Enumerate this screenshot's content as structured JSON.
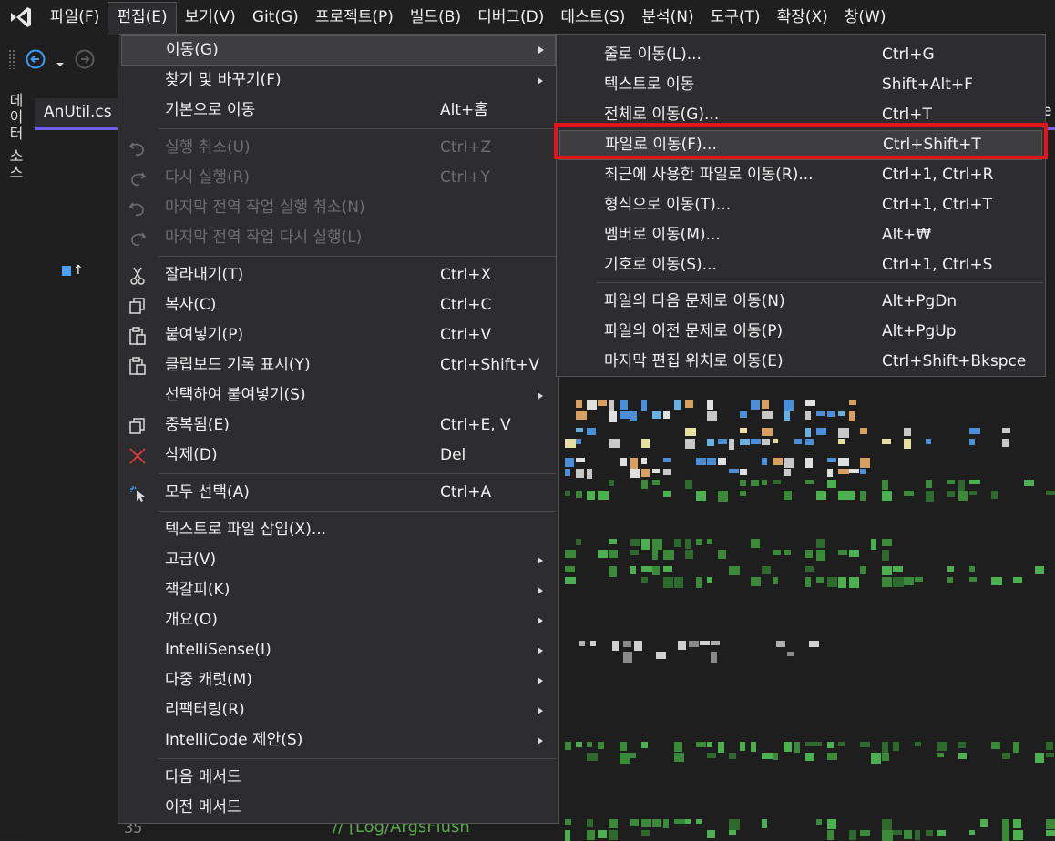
{
  "colors": {
    "accent": "#7160e8",
    "highlight_box": "#e3151a",
    "menu_bg": "#2d2d30",
    "disabled": "#6d6d6d"
  },
  "menubar": {
    "logo_icon": "visual-studio-logo-icon",
    "items": [
      "파일(F)",
      "편집(E)",
      "보기(V)",
      "Git(G)",
      "프로젝트(P)",
      "빌드(B)",
      "디버그(D)",
      "테스트(S)",
      "분석(N)",
      "도구(T)",
      "확장(X)",
      "창(W)"
    ],
    "open_index": 1
  },
  "toolbar": {
    "back_icon": "back-arrow-icon",
    "forward_icon": "forward-arrow-icon"
  },
  "side": {
    "data_sources_label": "데이터 소스"
  },
  "tabs": {
    "active": "AnUtil.cs",
    "overflow_char": "e"
  },
  "editor": {
    "line_number": "35",
    "comment_fragment": "// [Log/ArgsFlush"
  },
  "edit_menu": {
    "items": [
      {
        "label": "이동(G)",
        "shortcut": "",
        "submenu": true,
        "highlighted": true
      },
      {
        "label": "찾기 및 바꾸기(F)",
        "shortcut": "",
        "submenu": true
      },
      {
        "label": "기본으로 이동",
        "shortcut": "Alt+홈"
      },
      {
        "label": "실행 취소(U)",
        "shortcut": "Ctrl+Z",
        "disabled": true,
        "icon": "undo-icon"
      },
      {
        "label": "다시 실행(R)",
        "shortcut": "Ctrl+Y",
        "disabled": true,
        "icon": "redo-icon"
      },
      {
        "label": "마지막 전역 작업 실행 취소(N)",
        "shortcut": "",
        "disabled": true,
        "icon": "undo-global-icon"
      },
      {
        "label": "마지막 전역 작업 다시 실행(L)",
        "shortcut": "",
        "disabled": true,
        "icon": "redo-global-icon"
      },
      {
        "label": "잘라내기(T)",
        "shortcut": "Ctrl+X",
        "icon": "cut-icon"
      },
      {
        "label": "복사(C)",
        "shortcut": "Ctrl+C",
        "icon": "copy-icon"
      },
      {
        "label": "붙여넣기(P)",
        "shortcut": "Ctrl+V",
        "icon": "paste-icon"
      },
      {
        "label": "클립보드 기록 표시(Y)",
        "shortcut": "Ctrl+Shift+V",
        "icon": "clipboard-history-icon"
      },
      {
        "label": "선택하여 붙여넣기(S)",
        "shortcut": "",
        "submenu": true
      },
      {
        "label": "중복됨(E)",
        "shortcut": "Ctrl+E, V",
        "icon": "duplicate-icon"
      },
      {
        "label": "삭제(D)",
        "shortcut": "Del",
        "icon": "delete-icon"
      },
      {
        "label": "모두 선택(A)",
        "shortcut": "Ctrl+A",
        "icon": "select-all-icon"
      },
      {
        "label": "텍스트로 파일 삽입(X)...",
        "shortcut": ""
      },
      {
        "label": "고급(V)",
        "shortcut": "",
        "submenu": true
      },
      {
        "label": "책갈피(K)",
        "shortcut": "",
        "submenu": true
      },
      {
        "label": "개요(O)",
        "shortcut": "",
        "submenu": true
      },
      {
        "label": "IntelliSense(I)",
        "shortcut": "",
        "submenu": true
      },
      {
        "label": "다중 캐럿(M)",
        "shortcut": "",
        "submenu": true
      },
      {
        "label": "리팩터링(R)",
        "shortcut": "",
        "submenu": true
      },
      {
        "label": "IntelliCode 제안(S)",
        "shortcut": "",
        "submenu": true
      },
      {
        "label": "다음 메서드",
        "shortcut": ""
      },
      {
        "label": "이전 메서드",
        "shortcut": ""
      }
    ]
  },
  "goto_menu": {
    "items": [
      {
        "label": "줄로 이동(L)...",
        "shortcut": "Ctrl+G"
      },
      {
        "label": "텍스트로 이동",
        "shortcut": "Shift+Alt+F"
      },
      {
        "label": "전체로 이동(G)...",
        "shortcut": "Ctrl+T"
      },
      {
        "label": "파일로 이동(F)...",
        "shortcut": "Ctrl+Shift+T",
        "highlighted": true
      },
      {
        "label": "최근에 사용한 파일로 이동(R)...",
        "shortcut": "Ctrl+1, Ctrl+R"
      },
      {
        "label": "형식으로 이동(T)...",
        "shortcut": "Ctrl+1, Ctrl+T"
      },
      {
        "label": "멤버로 이동(M)...",
        "shortcut": "Alt+₩"
      },
      {
        "label": "기호로 이동(S)...",
        "shortcut": "Ctrl+1, Ctrl+S"
      },
      {
        "label": "파일의 다음 문제로 이동(N)",
        "shortcut": "Alt+PgDn"
      },
      {
        "label": "파일의 이전 문제로 이동(P)",
        "shortcut": "Alt+PgUp"
      },
      {
        "label": "마지막 편집 위치로 이동(E)",
        "shortcut": "Ctrl+Shift+Bkspce"
      }
    ]
  }
}
